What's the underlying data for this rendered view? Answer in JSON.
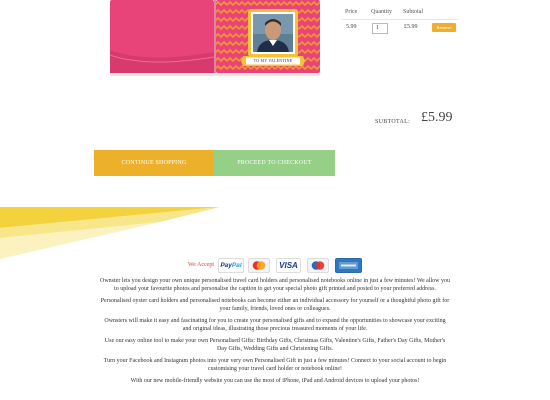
{
  "product": {
    "image_name": "personalised-travel-card-holder",
    "caption": "TO MY VALENTINE",
    "colors": {
      "holder_pink": "#e8447a",
      "pattern_orange": "#f09a2a",
      "frame_gold": "#f3c23a"
    }
  },
  "cart": {
    "headers": {
      "price": "Price",
      "quantity": "Quantity",
      "subtotal": "Subtotal"
    },
    "item": {
      "price": "5.99",
      "quantity": "1",
      "subtotal": "£5.99",
      "remove_label": "Remove"
    }
  },
  "totals": {
    "label": "SUBTOTAL:",
    "value": "£5.99"
  },
  "actions": {
    "continue_label": "CONTINUE SHOPPING",
    "checkout_label": "PROCEED TO CHECKOUT"
  },
  "payment": {
    "we_accept": "We Accept",
    "paypal_part1": "Pay",
    "paypal_part2": "Pal",
    "visa": "VISA",
    "cards": [
      "paypal-icon",
      "mastercard-icon",
      "visa-icon",
      "maestro-icon",
      "amex-icon"
    ]
  },
  "description": [
    "Ownster lets you design your own unique personalised travel card holders and personalised notebooks online in just a few minutes! We allow you to upload your favourite photos and personalise the caption to get your special photo gift printed and posted to your preferred address.",
    "Personalised oyster card holders and personalised notebooks can become either an individual accessory for yourself or a thoughtful photo gift for your family, friends, loved ones or colleagues.",
    "Ownsters will make it easy and fascinating for you to create your personalised gifts and to expand the opportunities to showcase your exciting and original ideas, illustrating those precious treasured moments of your life.",
    "Use our easy online tool to make your own Personalised Gifts: Birthday Gifts, Christmas Gifts, Valentine's Gifts, Father's Day Gifts, Mother's Day Gifts, Wedding Gifts and Christening Gifts.",
    "Turn your Facebook and Instagram photos into your very own Personalised Gift in just a few minutes! Connect to your social account to begin customising your travel card holder or notebook online!",
    "With our new mobile-friendly website you can use the most of iPhone, iPad and Android devices to upload your photos!"
  ],
  "colors": {
    "accent_orange": "#edb02b",
    "accent_green": "#96cf86",
    "we_accept_red": "#e1442c",
    "stripe_yellow": "#f3d23d"
  }
}
